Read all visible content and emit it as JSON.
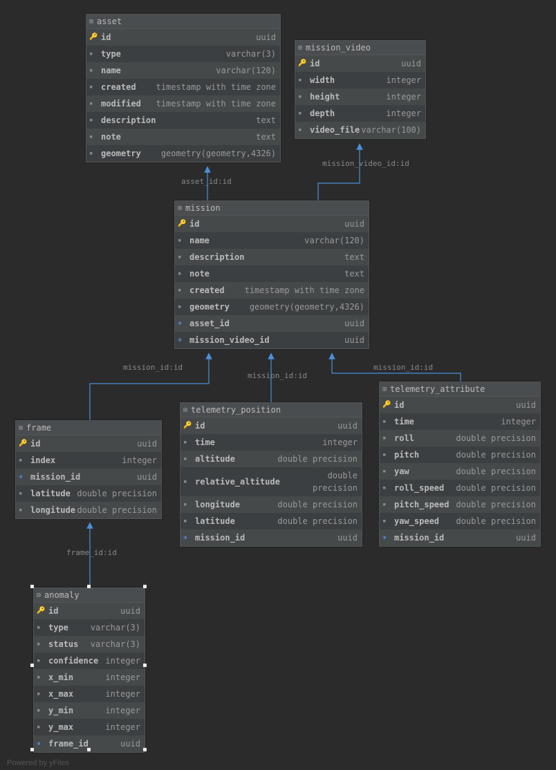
{
  "footer": "Powered by yFiles",
  "labels": {
    "asset_id": "asset_id:id",
    "mission_video_id": "mission_video_id:id",
    "mission_id_left": "mission_id:id",
    "mission_id_mid": "mission_id:id",
    "mission_id_right": "mission_id:id",
    "frame_id": "frame_id:id"
  },
  "tables": {
    "asset": {
      "name": "asset",
      "columns": [
        {
          "icon": "pk",
          "name": "id",
          "type": "uuid"
        },
        {
          "icon": "col",
          "name": "type",
          "type": "varchar(3)"
        },
        {
          "icon": "col",
          "name": "name",
          "type": "varchar(120)"
        },
        {
          "icon": "col",
          "name": "created",
          "type": "timestamp with time zone"
        },
        {
          "icon": "col",
          "name": "modified",
          "type": "timestamp with time zone"
        },
        {
          "icon": "col",
          "name": "description",
          "type": "text"
        },
        {
          "icon": "col",
          "name": "note",
          "type": "text"
        },
        {
          "icon": "col",
          "name": "geometry",
          "type": "geometry(geometry,4326)"
        }
      ]
    },
    "mission_video": {
      "name": "mission_video",
      "columns": [
        {
          "icon": "pk",
          "name": "id",
          "type": "uuid"
        },
        {
          "icon": "col",
          "name": "width",
          "type": "integer"
        },
        {
          "icon": "col",
          "name": "height",
          "type": "integer"
        },
        {
          "icon": "col",
          "name": "depth",
          "type": "integer"
        },
        {
          "icon": "col",
          "name": "video_file",
          "type": "varchar(100)"
        }
      ]
    },
    "mission": {
      "name": "mission",
      "columns": [
        {
          "icon": "pk",
          "name": "id",
          "type": "uuid"
        },
        {
          "icon": "col",
          "name": "name",
          "type": "varchar(120)"
        },
        {
          "icon": "col",
          "name": "description",
          "type": "text"
        },
        {
          "icon": "col",
          "name": "note",
          "type": "text"
        },
        {
          "icon": "col",
          "name": "created",
          "type": "timestamp with time zone"
        },
        {
          "icon": "col",
          "name": "geometry",
          "type": "geometry(geometry,4326)"
        },
        {
          "icon": "fk",
          "name": "asset_id",
          "type": "uuid"
        },
        {
          "icon": "fk",
          "name": "mission_video_id",
          "type": "uuid"
        }
      ]
    },
    "frame": {
      "name": "frame",
      "columns": [
        {
          "icon": "pk",
          "name": "id",
          "type": "uuid"
        },
        {
          "icon": "col",
          "name": "index",
          "type": "integer"
        },
        {
          "icon": "fk",
          "name": "mission_id",
          "type": "uuid"
        },
        {
          "icon": "col",
          "name": "latitude",
          "type": "double precision"
        },
        {
          "icon": "col",
          "name": "longitude",
          "type": "double precision"
        }
      ]
    },
    "telemetry_position": {
      "name": "telemetry_position",
      "columns": [
        {
          "icon": "pk",
          "name": "id",
          "type": "uuid"
        },
        {
          "icon": "col",
          "name": "time",
          "type": "integer"
        },
        {
          "icon": "col",
          "name": "altitude",
          "type": "double precision"
        },
        {
          "icon": "col",
          "name": "relative_altitude",
          "type": "double precision"
        },
        {
          "icon": "col",
          "name": "longitude",
          "type": "double precision"
        },
        {
          "icon": "col",
          "name": "latitude",
          "type": "double precision"
        },
        {
          "icon": "fk",
          "name": "mission_id",
          "type": "uuid"
        }
      ]
    },
    "telemetry_attribute": {
      "name": "telemetry_attribute",
      "columns": [
        {
          "icon": "pk",
          "name": "id",
          "type": "uuid"
        },
        {
          "icon": "col",
          "name": "time",
          "type": "integer"
        },
        {
          "icon": "col",
          "name": "roll",
          "type": "double precision"
        },
        {
          "icon": "col",
          "name": "pitch",
          "type": "double precision"
        },
        {
          "icon": "col",
          "name": "yaw",
          "type": "double precision"
        },
        {
          "icon": "col",
          "name": "roll_speed",
          "type": "double precision"
        },
        {
          "icon": "col",
          "name": "pitch_speed",
          "type": "double precision"
        },
        {
          "icon": "col",
          "name": "yaw_speed",
          "type": "double precision"
        },
        {
          "icon": "fk",
          "name": "mission_id",
          "type": "uuid"
        }
      ]
    },
    "anomaly": {
      "name": "anomaly",
      "columns": [
        {
          "icon": "pk",
          "name": "id",
          "type": "uuid"
        },
        {
          "icon": "col",
          "name": "type",
          "type": "varchar(3)"
        },
        {
          "icon": "col",
          "name": "status",
          "type": "varchar(3)"
        },
        {
          "icon": "col",
          "name": "confidence",
          "type": "integer"
        },
        {
          "icon": "col",
          "name": "x_min",
          "type": "integer"
        },
        {
          "icon": "col",
          "name": "x_max",
          "type": "integer"
        },
        {
          "icon": "col",
          "name": "y_min",
          "type": "integer"
        },
        {
          "icon": "col",
          "name": "y_max",
          "type": "integer"
        },
        {
          "icon": "fk",
          "name": "frame_id",
          "type": "uuid"
        }
      ]
    }
  }
}
